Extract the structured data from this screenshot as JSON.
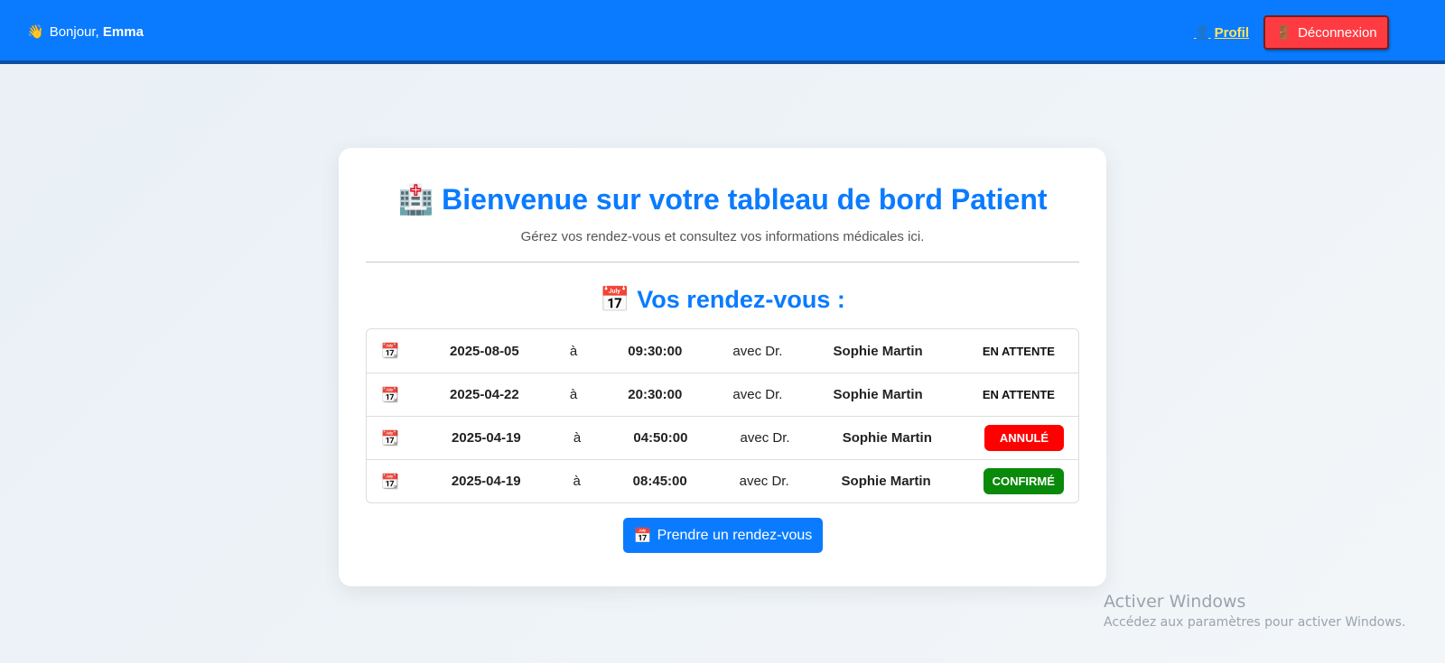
{
  "navbar": {
    "greeting_prefix": "Bonjour,",
    "user_name": "Emma",
    "profile_label": "Profil",
    "logout_label": "Déconnexion"
  },
  "dashboard": {
    "title": "Bienvenue sur votre tableau de bord Patient",
    "subtitle": "Gérez vos rendez-vous et consultez vos informations médicales ici.",
    "appointments_heading": "Vos rendez-vous :",
    "appointments": [
      {
        "date": "2025-08-05",
        "at": "à",
        "time": "09:30:00",
        "with": "avec Dr.",
        "doctor": "Sophie Martin",
        "status": "EN ATTENTE"
      },
      {
        "date": "2025-04-22",
        "at": "à",
        "time": "20:30:00",
        "with": "avec Dr.",
        "doctor": "Sophie Martin",
        "status": "EN ATTENTE"
      },
      {
        "date": "2025-04-19",
        "at": "à",
        "time": "04:50:00",
        "with": "avec Dr.",
        "doctor": "Sophie Martin",
        "status": "ANNULÉ"
      },
      {
        "date": "2025-04-19",
        "at": "à",
        "time": "08:45:00",
        "with": "avec Dr.",
        "doctor": "Sophie Martin",
        "status": "CONFIRMÉ"
      }
    ],
    "book_button_label": "Prendre un rendez-vous"
  },
  "icons": {
    "wave": "waving-hand-icon",
    "profile": "person-icon",
    "logout": "door-icon",
    "hospital": "hospital-icon",
    "calendar": "calendar-icon",
    "row_calendar": "calendar-icon"
  },
  "colors": {
    "brand": "#0a7bff",
    "logout": "#ff3b42",
    "cancelled": "#ff0000",
    "confirmed": "#0a8a0a",
    "profile_link": "#ffe45c"
  },
  "watermark": {
    "line1": "Activer Windows",
    "line2": "Accédez aux paramètres pour activer Windows."
  }
}
